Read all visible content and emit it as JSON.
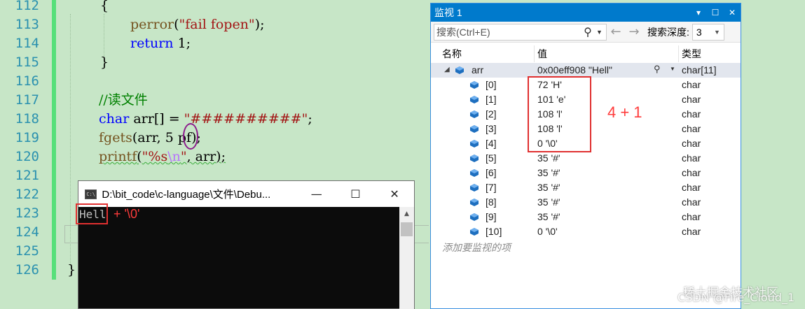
{
  "editor": {
    "line_numbers": [
      "112",
      "113",
      "114",
      "115",
      "116",
      "117",
      "118",
      "119",
      "120",
      "121",
      "122",
      "123",
      "124",
      "125",
      "126"
    ],
    "line_112": "{",
    "line_113_fn": "perror",
    "line_113_str": "\"fail fopen\"",
    "line_114_kw": "return",
    "line_114_val": " 1;",
    "line_115": "}",
    "line_117": "//读文件",
    "line_118_kw": "char",
    "line_118_mid": " arr[] = ",
    "line_118_str": "\"##########\"",
    "line_118_end": ";",
    "line_119_fn": "fgets",
    "line_119_a": "(arr, ",
    "line_119_num": "5",
    "line_119_b": " pf);",
    "line_120_fn": "printf",
    "line_120_str1": "\"%s",
    "line_120_esc": "\\n",
    "line_120_str2": "\"",
    "line_120_end": ", arr);",
    "line_126": "}"
  },
  "console": {
    "title": "D:\\bit_code\\c-language\\文件\\Debu...",
    "output": "Hell",
    "annotation": "+ '\\0'",
    "minimize_glyph": "—",
    "maximize_glyph": "☐",
    "close_glyph": "✕",
    "icon_text": "C:\\"
  },
  "watch": {
    "title": "监视 1",
    "title_buttons": [
      "▾",
      "☐",
      "✕"
    ],
    "search_placeholder": "搜索(Ctrl+E)",
    "back_glyph": "←",
    "forward_glyph": "→",
    "depth_label": "搜索深度:",
    "depth_value": "3",
    "headers": {
      "name": "名称",
      "value": "值",
      "type": "类型"
    },
    "root": {
      "name": "arr",
      "value": "0x00eff908 \"Hell\"",
      "type": "char[11]"
    },
    "rows": [
      {
        "name": "[0]",
        "value": "72 'H'",
        "type": "char"
      },
      {
        "name": "[1]",
        "value": "101 'e'",
        "type": "char"
      },
      {
        "name": "[2]",
        "value": "108 'l'",
        "type": "char"
      },
      {
        "name": "[3]",
        "value": "108 'l'",
        "type": "char"
      },
      {
        "name": "[4]",
        "value": "0 '\\0'",
        "type": "char"
      },
      {
        "name": "[5]",
        "value": "35 '#'",
        "type": "char"
      },
      {
        "name": "[6]",
        "value": "35 '#'",
        "type": "char"
      },
      {
        "name": "[7]",
        "value": "35 '#'",
        "type": "char"
      },
      {
        "name": "[8]",
        "value": "35 '#'",
        "type": "char"
      },
      {
        "name": "[9]",
        "value": "35 '#'",
        "type": "char"
      },
      {
        "name": "[10]",
        "value": "0 '\\0'",
        "type": "char"
      }
    ],
    "add_item_label": "添加要监视的项",
    "annotation": "4 + 1"
  },
  "watermark": {
    "line1": "稀土掘金技术社区",
    "line2": "CSDN @Fire_Cloud_1"
  },
  "colors": {
    "editor_bg": "#c7e6c7",
    "title_blue": "#007acc",
    "annotation_red": "#e03030"
  }
}
